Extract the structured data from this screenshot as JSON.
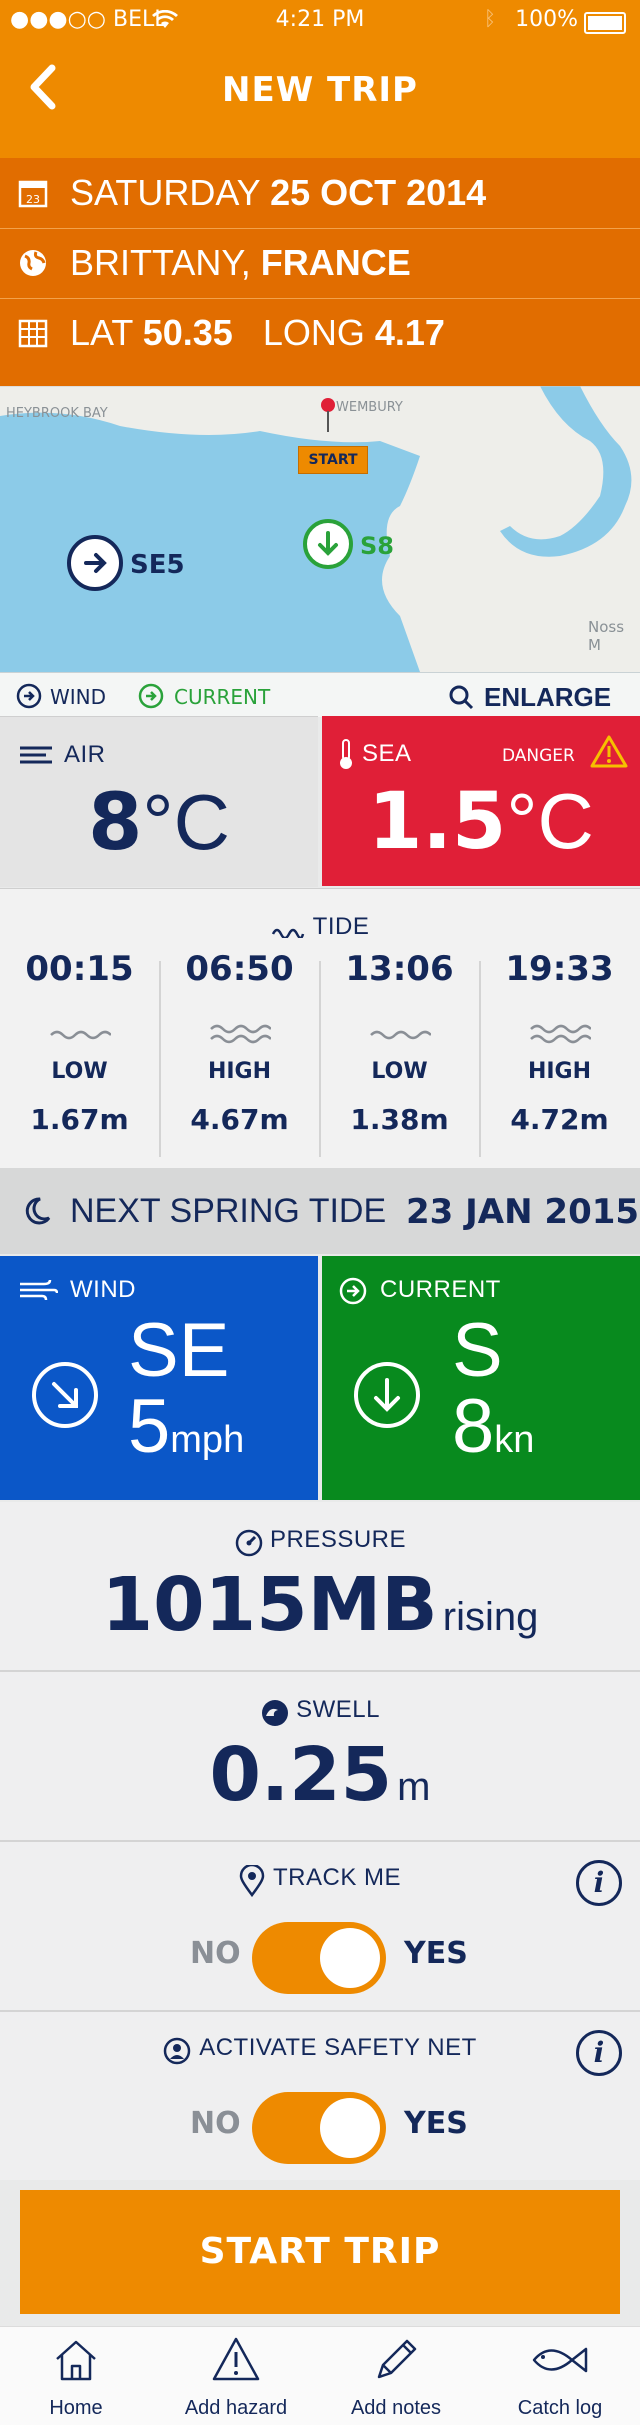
{
  "status_bar": {
    "carrier": "●●●○○ BELL",
    "time": "4:21 PM",
    "battery": "100%"
  },
  "header": {
    "title": "NEW TRIP",
    "back_icon": "chevron-left-icon"
  },
  "trip_info": {
    "date_prefix": "SATURDAY",
    "date_value": "25 OCT 2014",
    "place_prefix": "BRITTANY,",
    "place_value": "FRANCE",
    "lat_label": "LAT",
    "lat_value": "50.35",
    "long_label": "LONG",
    "long_value": "4.17"
  },
  "map": {
    "labels": {
      "place1": "HEYBROOK BAY",
      "place2": "WEMBURY",
      "place3": "Noss M"
    },
    "start_marker": "START",
    "wind_marker": "SE5",
    "current_marker": "S8",
    "legend": {
      "wind": "WIND",
      "current": "CURRENT",
      "enlarge": "ENLARGE"
    }
  },
  "air": {
    "label": "AIR",
    "value": "8",
    "unit": "°C"
  },
  "sea": {
    "label": "SEA",
    "status": "DANGER",
    "value": "1.5",
    "unit": "°C"
  },
  "tide": {
    "label": "TIDE",
    "entries": [
      {
        "time": "00:15",
        "type": "LOW",
        "height": "1.67m"
      },
      {
        "time": "06:50",
        "type": "HIGH",
        "height": "4.67m"
      },
      {
        "time": "13:06",
        "type": "LOW",
        "height": "1.38m"
      },
      {
        "time": "19:33",
        "type": "HIGH",
        "height": "4.72m"
      }
    ]
  },
  "spring_tide": {
    "label": "NEXT SPRING TIDE",
    "date": "23 JAN 2015"
  },
  "wind": {
    "label": "WIND",
    "direction": "SE",
    "speed": "5",
    "unit": "mph"
  },
  "current": {
    "label": "CURRENT",
    "direction": "S",
    "speed": "8",
    "unit": "kn"
  },
  "pressure": {
    "label": "PRESSURE",
    "value": "1015MB",
    "trend": "rising"
  },
  "swell": {
    "label": "SWELL",
    "value": "0.25",
    "unit": "m"
  },
  "track_me": {
    "label": "TRACK ME",
    "no": "NO",
    "yes": "YES",
    "on": true
  },
  "safety_net": {
    "label": "ACTIVATE SAFETY NET",
    "no": "NO",
    "yes": "YES",
    "on": true
  },
  "start_button": "START TRIP",
  "tabs": [
    {
      "label": "Home",
      "icon": "home-icon"
    },
    {
      "label": "Add hazard",
      "icon": "warning-icon"
    },
    {
      "label": "Add notes",
      "icon": "pencil-icon"
    },
    {
      "label": "Catch log",
      "icon": "fish-icon"
    }
  ],
  "colors": {
    "orange": "#ee8a00",
    "dark_orange": "#e16d00",
    "navy": "#14285a",
    "danger_red": "#e01f37",
    "wind_blue": "#0b57c8",
    "current_green": "#088a1e"
  }
}
